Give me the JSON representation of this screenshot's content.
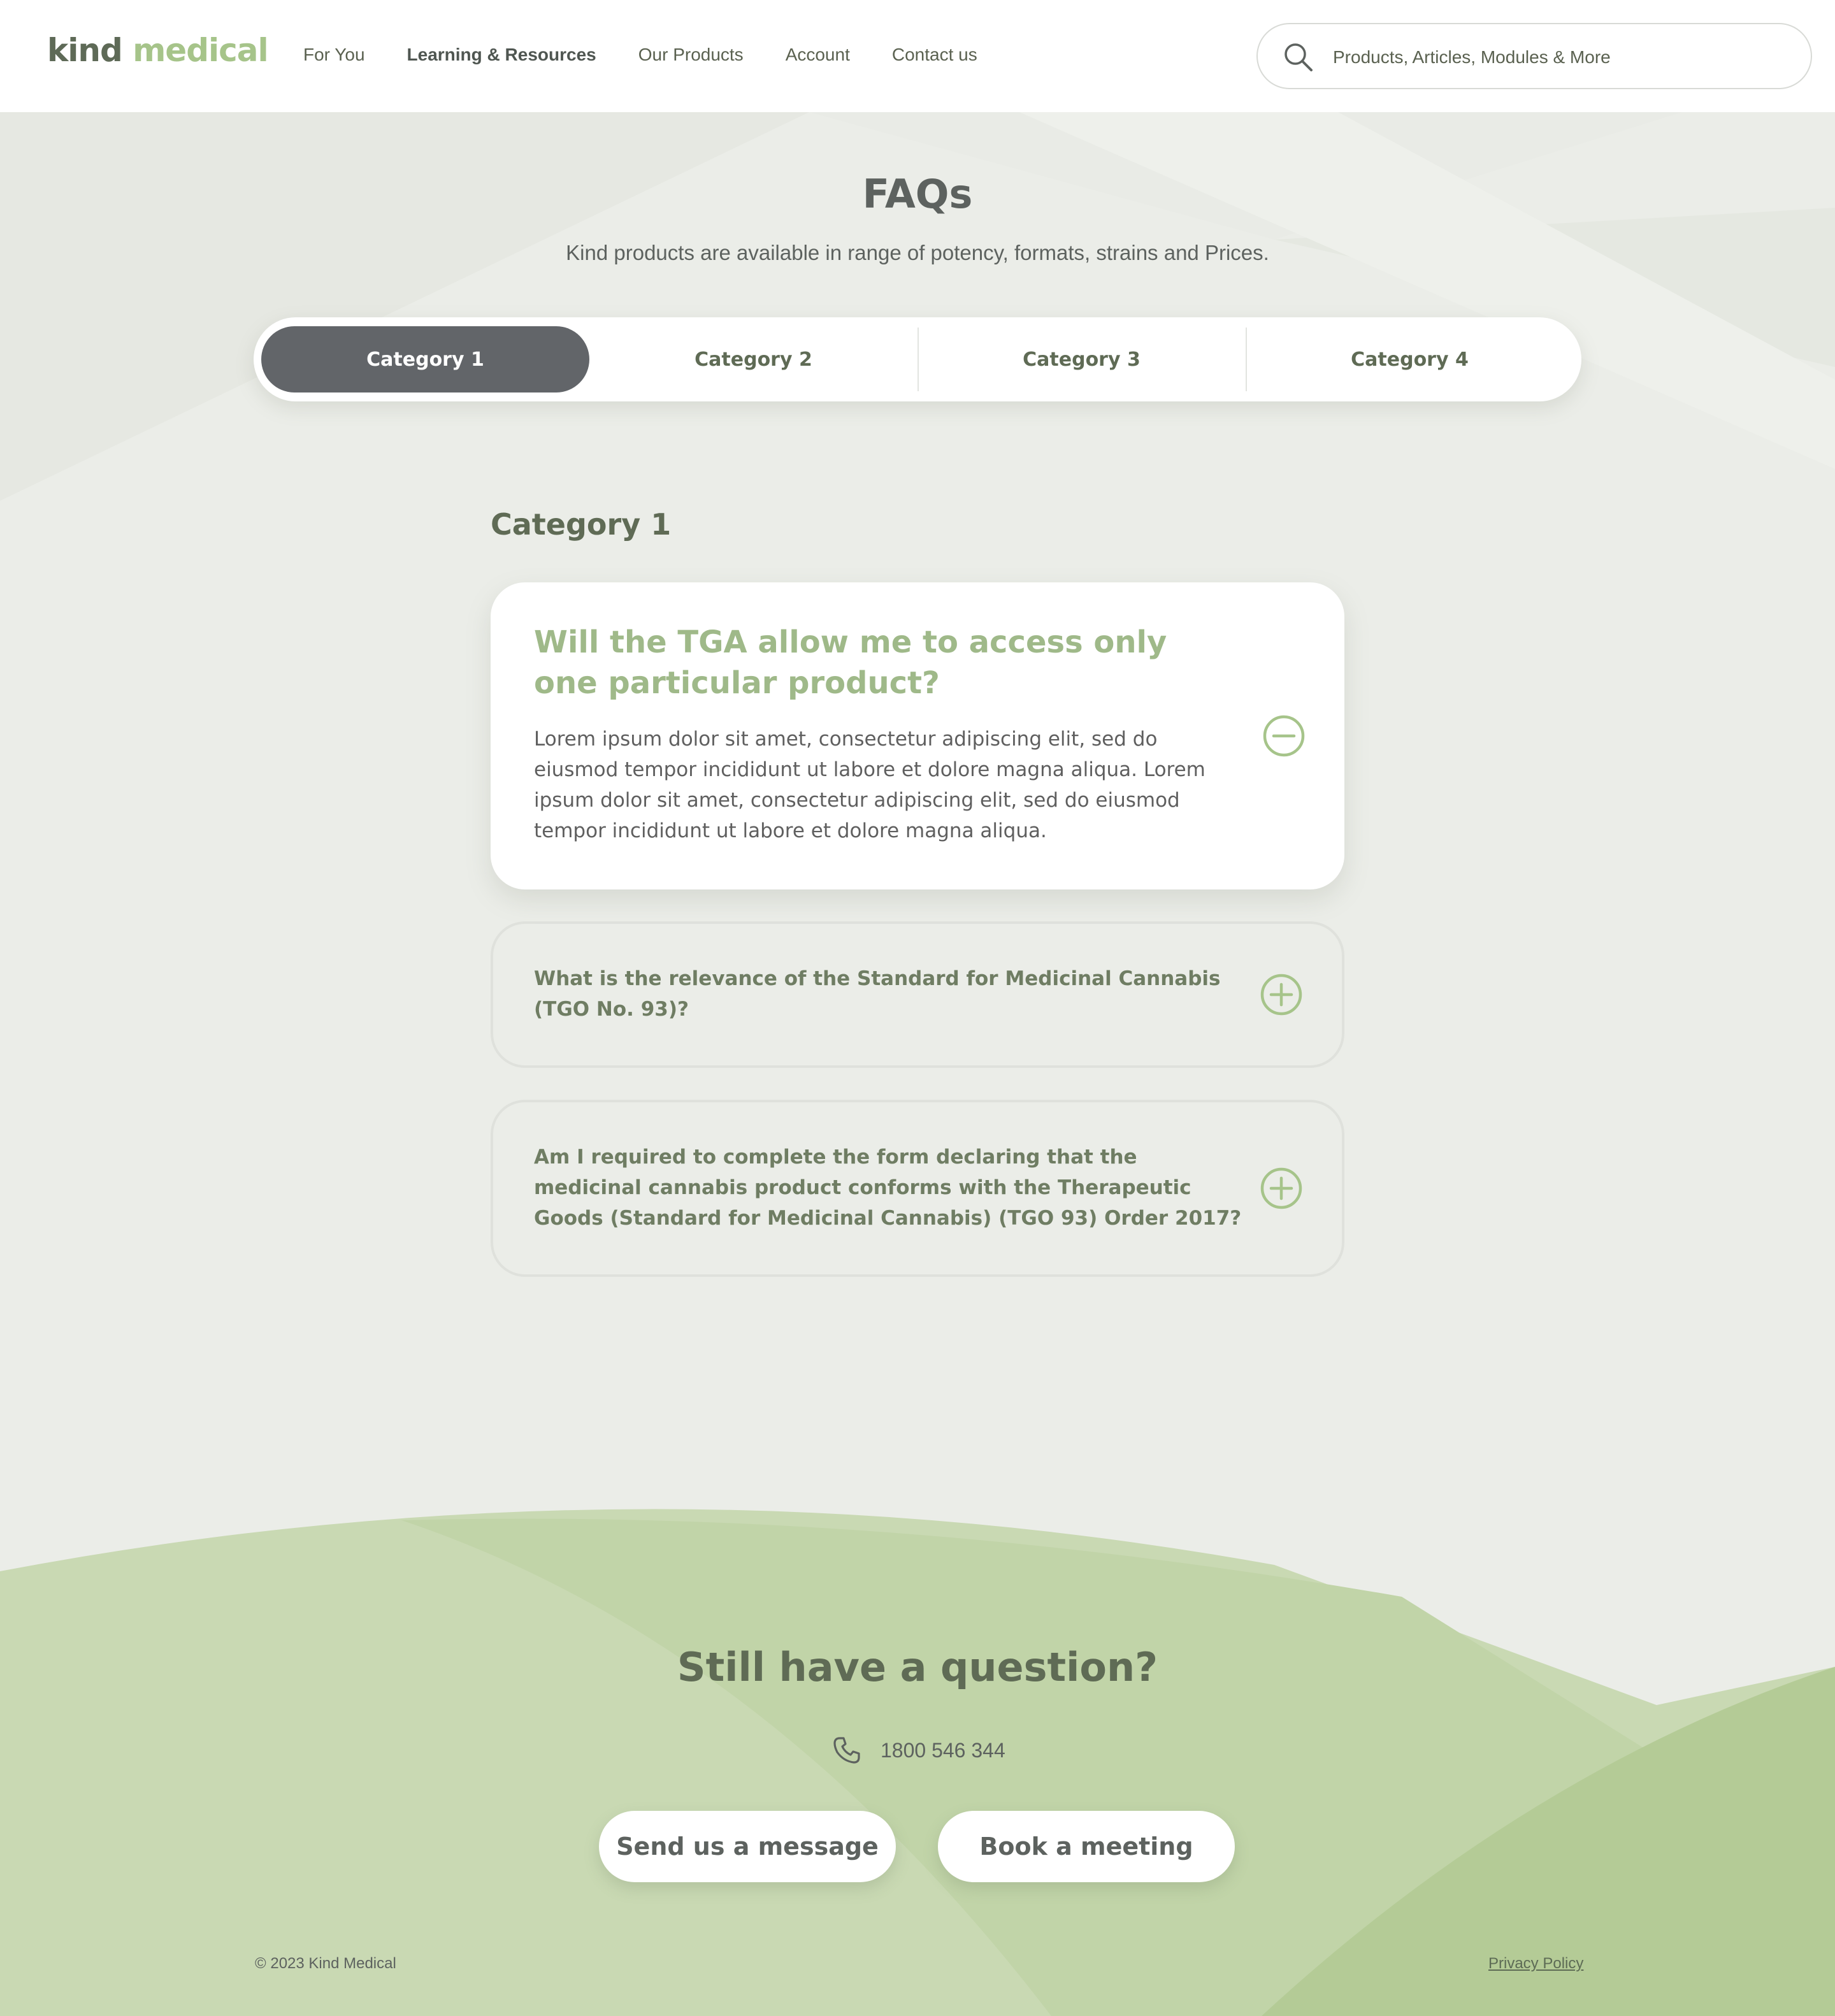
{
  "header": {
    "logo": {
      "kind": "kind",
      "medical": "medical"
    },
    "nav": [
      "For You",
      "Learning & Resources",
      "Our Products",
      "Account",
      "Contact us"
    ],
    "nav_active": "Learning & Resources",
    "search": {
      "placeholder": "Products, Articles, Modules & More",
      "icon": "search-icon"
    }
  },
  "hero": {
    "title": "FAQs",
    "subtitle": "Kind products are available in range of potency, formats, strains and Prices."
  },
  "tabs": [
    "Category 1",
    "Category 2",
    "Category 3",
    "Category 4"
  ],
  "active_tab": "Category 1",
  "section": {
    "title": "Category 1"
  },
  "faqs": [
    {
      "question": "Will the TGA allow me to access only one particular product?",
      "answer": "Lorem ipsum dolor sit amet, consectetur adipiscing elit, sed do eiusmod tempor incididunt ut labore et dolore magna aliqua. Lorem ipsum dolor sit amet, consectetur adipiscing elit, sed do eiusmod tempor incididunt ut labore et dolore magna aliqua.",
      "expanded": true,
      "icon": "minus-circle-icon"
    },
    {
      "question": "What is the relevance of the Standard for Medicinal Cannabis (TGO No. 93)?",
      "expanded": false,
      "icon": "plus-circle-icon"
    },
    {
      "question": "Am I required to complete the form declaring that the medicinal cannabis product conforms with the Therapeutic Goods (Standard for Medicinal Cannabis) (TGO 93) Order 2017?",
      "expanded": false,
      "icon": "plus-circle-icon"
    }
  ],
  "cta": {
    "title": "Still have a question?",
    "phone": "1800 546 344",
    "phone_icon": "phone-icon",
    "buttons": [
      "Send us a message",
      "Book a meeting"
    ]
  },
  "footer": {
    "copyright": "© 2023 Kind Medical",
    "privacy": "Privacy Policy"
  },
  "colors": {
    "accent_green": "#a6c48a",
    "dark_text": "#5f6b55",
    "active_tab": "#626569",
    "background": "#ebede8",
    "footer_green": "#c3d6aa"
  }
}
